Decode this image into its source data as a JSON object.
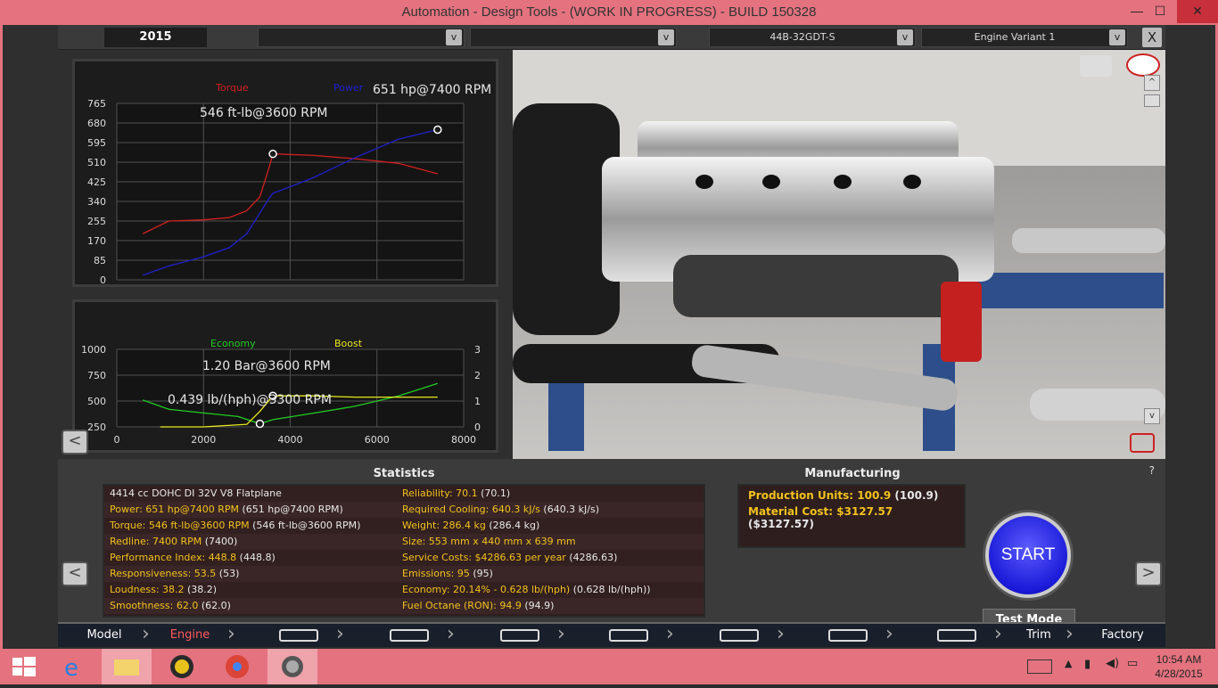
{
  "window": {
    "title": "Automation - Design Tools - (WORK IN PROGRESS) - BUILD 150328",
    "minimize": "—",
    "maximize": "☐",
    "close": "✕"
  },
  "topbar": {
    "year": "2015",
    "dropdown1": "",
    "dropdown2": "",
    "dropdown3": "44B-32GDT-S",
    "dropdown4": "Engine Variant 1",
    "arrow": "v",
    "close": "X"
  },
  "colors": {
    "torque": "#d42020",
    "power": "#2020d0",
    "economy": "#22cc22",
    "boost": "#e8e820",
    "stat_label": "#f2c21c",
    "accent": "#e4737f"
  },
  "chart_data": [
    {
      "type": "line",
      "legend": [
        "Torque",
        "Power"
      ],
      "annotations": [
        "546 ft-lb@3600 RPM",
        "651 hp@7400 RPM"
      ],
      "x_ticks": [
        "0",
        "2000",
        "4000",
        "6000",
        "8000"
      ],
      "y_ticks": [
        "0",
        "85",
        "170",
        "255",
        "340",
        "425",
        "510",
        "595",
        "680",
        "765"
      ],
      "xlim": [
        0,
        8000
      ],
      "ylim": [
        0,
        765
      ],
      "series": [
        {
          "name": "Torque",
          "x": [
            600,
            1200,
            2000,
            2600,
            3000,
            3300,
            3500,
            3600,
            4500,
            5500,
            6500,
            7400
          ],
          "y": [
            200,
            255,
            260,
            270,
            300,
            360,
            480,
            546,
            540,
            525,
            505,
            460
          ]
        },
        {
          "name": "Power",
          "x": [
            600,
            1200,
            2000,
            2600,
            3000,
            3300,
            3500,
            3600,
            4500,
            5500,
            6500,
            7400
          ],
          "y": [
            20,
            60,
            100,
            140,
            200,
            290,
            350,
            375,
            440,
            530,
            610,
            651
          ]
        }
      ]
    },
    {
      "type": "line",
      "legend": [
        "Economy",
        "Boost"
      ],
      "annotations": [
        "1.20 Bar@3600 RPM",
        "0.439 lb/(hph)@3300 RPM"
      ],
      "x_ticks": [
        "0",
        "2000",
        "4000",
        "6000",
        "8000"
      ],
      "y_ticks_left": [
        "250",
        "500",
        "750",
        "1000"
      ],
      "y_ticks_right": [
        "0",
        "1",
        "2",
        "3"
      ],
      "xlim": [
        0,
        8000
      ],
      "ylim": [
        250,
        1000
      ],
      "ylim_right": [
        0,
        3
      ],
      "series": [
        {
          "name": "Economy",
          "x": [
            600,
            1200,
            2000,
            2800,
            3300,
            3600,
            4500,
            5500,
            6500,
            7400
          ],
          "y": [
            510,
            420,
            385,
            350,
            280,
            320,
            380,
            450,
            550,
            670
          ]
        },
        {
          "name": "Boost",
          "x": [
            1000,
            2000,
            3000,
            3300,
            3600,
            4500,
            5500,
            6500,
            7400
          ],
          "y": [
            0,
            0,
            0.1,
            0.6,
            1.2,
            1.2,
            1.15,
            1.15,
            1.15
          ]
        }
      ]
    }
  ],
  "viewport": {
    "scroll_up": "^",
    "scroll_down": "v"
  },
  "statistics": {
    "header": "Statistics",
    "rows": [
      {
        "l": "4414 cc DOHC DI 32V V8 Flatplane",
        "v": "",
        "l2": "Reliability: 70.1",
        "v2": " (70.1)"
      },
      {
        "l": "Power: 651 hp@7400 RPM",
        "v": " (651 hp@7400 RPM)",
        "l2": "Required Cooling: 640.3 kJ/s",
        "v2": " (640.3 kJ/s)"
      },
      {
        "l": "Torque: 546 ft-lb@3600 RPM",
        "v": " (546 ft-lb@3600 RPM)",
        "l2": "Weight: 286.4 kg",
        "v2": " (286.4 kg)"
      },
      {
        "l": "Redline: 7400 RPM",
        "v": " (7400)",
        "l2": "Size: 553 mm x 440 mm x 639 mm",
        "v2": ""
      },
      {
        "l": "Performance Index: 448.8",
        "v": " (448.8)",
        "l2": "Service Costs: $4286.63 per year",
        "v2": " (4286.63)"
      },
      {
        "l": "Responsiveness: 53.5",
        "v": " (53)",
        "l2": "Emissions: 95",
        "v2": " (95)"
      },
      {
        "l": "Loudness: 38.2",
        "v": " (38.2)",
        "l2": "Economy: 20.14% - 0.628 lb/(hph)",
        "v2": " (0.628 lb/(hph))"
      },
      {
        "l": "Smoothness: 62.0",
        "v": " (62.0)",
        "l2": "Fuel Octane (RON): 94.9",
        "v2": " (94.9)"
      }
    ]
  },
  "manufacturing": {
    "header": "Manufacturing",
    "units_label": "Production Units: 100.9",
    "units_val": " (100.9)",
    "cost_label": "Material Cost: $3127.57",
    "cost_val": " ($3127.57)"
  },
  "controls": {
    "start": "START",
    "test_mode": "Test Mode",
    "help": "?",
    "prev": "<",
    "next": ">",
    "chart_prev": "<"
  },
  "tabs": [
    "Model",
    "Engine",
    "",
    "",
    "",
    "",
    "",
    "",
    "",
    "Trim",
    "Factory"
  ],
  "taskbar": {
    "time": "10:54 AM",
    "date": "4/28/2015"
  }
}
